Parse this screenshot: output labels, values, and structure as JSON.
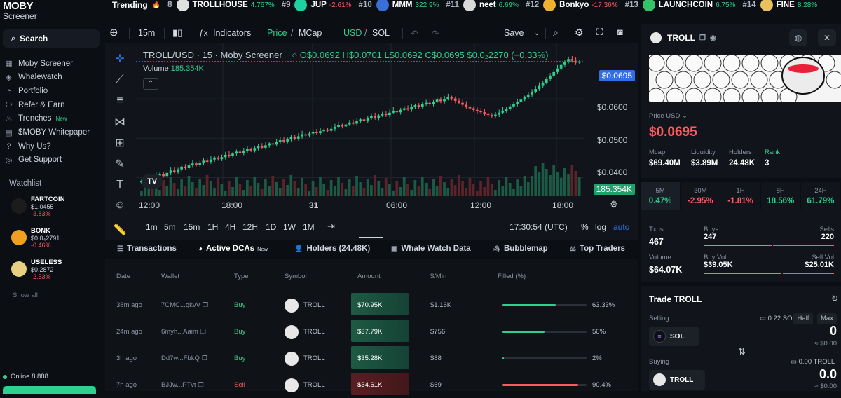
{
  "logo": {
    "line1": "MOBY",
    "line2": "Screener"
  },
  "trending": {
    "label": "Trending",
    "items": [
      {
        "rank": "8",
        "name": "TROLLHOUSE",
        "pct": "4.767%",
        "dir": "up",
        "color": "#e0e0e0"
      },
      {
        "rank": "#9",
        "name": "JUP",
        "pct": "-2.61%",
        "dir": "down",
        "color": "#1fd0a0"
      },
      {
        "rank": "#10",
        "name": "MMM",
        "pct": "322.9%",
        "dir": "up",
        "color": "#3a6fd8"
      },
      {
        "rank": "#11",
        "name": "neet",
        "pct": "6.69%",
        "dir": "up",
        "color": "#d9d9d9"
      },
      {
        "rank": "#12",
        "name": "Bonkyo",
        "pct": "-17.36%",
        "dir": "down",
        "color": "#f0b030"
      },
      {
        "rank": "#13",
        "name": "LAUNCHCOIN",
        "pct": "6.75%",
        "dir": "up",
        "color": "#33c46a"
      },
      {
        "rank": "#14",
        "name": "FINE",
        "pct": "8.28%",
        "dir": "up",
        "color": "#e8c060"
      }
    ]
  },
  "sidebar": {
    "search_label": "Search",
    "items": [
      {
        "label": "Moby Screener",
        "icon": "grid-icon"
      },
      {
        "label": "Whalewatch",
        "icon": "whale-icon"
      },
      {
        "label": "Portfolio",
        "icon": "pie-icon"
      },
      {
        "label": "Refer & Earn",
        "icon": "gift-icon"
      },
      {
        "label": "Trenches",
        "icon": "trench-icon",
        "badge": "New"
      },
      {
        "label": "$MOBY Whitepaper",
        "icon": "doc-icon"
      },
      {
        "label": "Why Us?",
        "icon": "question-icon"
      },
      {
        "label": "Get Support",
        "icon": "support-icon"
      }
    ],
    "watchlist_title": "Watchlist",
    "watchlist": [
      {
        "name": "FARTCOIN",
        "price": "$1.0455",
        "pct": "-3.83%",
        "color": "#1c1c1c"
      },
      {
        "name": "BONK",
        "price": "$0.0₄2791",
        "pct": "-0.46%",
        "color": "#f0a020"
      },
      {
        "name": "USELESS",
        "price": "$0.2872",
        "pct": "-2.53%",
        "color": "#e8d080"
      }
    ],
    "show_all": "Show all",
    "online": "Online 8,888"
  },
  "chart_toolbar": {
    "interval": "15m",
    "indicators": "Indicators",
    "price": "Price",
    "mcap": "MCap",
    "usd": "USD",
    "sol": "SOL",
    "save": "Save",
    "slash": "/"
  },
  "chart": {
    "legend_title": "TROLL/USD · 15 · Moby Screener",
    "ohlc": {
      "o": "O$0.0692",
      "h": "H$0.0701",
      "l": "L$0.0692",
      "c": "C$0.0695",
      "chg": "$0.0₂2270 (+0.33%)"
    },
    "volume_label": "Volume",
    "volume_value": "185.354K",
    "price_tag": "$0.0695",
    "volume_tag": "185.354K",
    "y_ticks": [
      "$0.0600",
      "$0.0500",
      "$0.0400"
    ],
    "x_ticks": [
      "12:00",
      "18:00",
      "31",
      "06:00",
      "12:00",
      "18:00"
    ],
    "tv_logo": "TV",
    "timeframes": [
      "1m",
      "5m",
      "15m",
      "1H",
      "4H",
      "12H",
      "1D",
      "1W",
      "1M"
    ],
    "clock": "17:30:54 (UTC)",
    "pct": "%",
    "log": "log",
    "auto": "auto"
  },
  "chart_data": {
    "type": "candlestick",
    "title": "TROLL/USD · 15 · Moby Screener",
    "ylim": [
      0.036,
      0.073
    ],
    "y_ticks": [
      0.04,
      0.05,
      0.06
    ],
    "x_ticks": [
      "12:00",
      "18:00",
      "31",
      "06:00",
      "12:00",
      "18:00"
    ],
    "close": [
      0.0392,
      0.0396,
      0.0401,
      0.0397,
      0.0405,
      0.0409,
      0.0404,
      0.0412,
      0.0418,
      0.0415,
      0.0421,
      0.0428,
      0.0424,
      0.0431,
      0.0436,
      0.0432,
      0.0438,
      0.0443,
      0.044,
      0.0446,
      0.0451,
      0.0447,
      0.0452,
      0.0458,
      0.0455,
      0.0461,
      0.0466,
      0.0462,
      0.0468,
      0.0472,
      0.0469,
      0.0475,
      0.048,
      0.0476,
      0.0482,
      0.0487,
      0.0484,
      0.0491,
      0.0495,
      0.0492,
      0.0498,
      0.0503,
      0.0499,
      0.0505,
      0.051,
      0.0507,
      0.0512,
      0.0516,
      0.0513,
      0.0518,
      0.0522,
      0.0519,
      0.0524,
      0.0529,
      0.0533,
      0.053,
      0.0535,
      0.054,
      0.0537,
      0.0543,
      0.0548,
      0.0545,
      0.0551,
      0.0556,
      0.0552,
      0.0558,
      0.0562,
      0.0559,
      0.0565,
      0.057,
      0.0566,
      0.0572,
      0.0576,
      0.0573,
      0.0579,
      0.0584,
      0.058,
      0.0586,
      0.059,
      0.0587,
      0.0593,
      0.0598,
      0.0594,
      0.06,
      0.0604,
      0.0601,
      0.0595,
      0.059,
      0.0585,
      0.058,
      0.0576,
      0.0572,
      0.0569,
      0.0566,
      0.0562,
      0.0559,
      0.0556,
      0.056,
      0.0565,
      0.057,
      0.0575,
      0.0581,
      0.0586,
      0.0592,
      0.0598,
      0.0604,
      0.0611,
      0.0618,
      0.0625,
      0.0633,
      0.0641,
      0.065,
      0.0659,
      0.0668,
      0.0677,
      0.0686,
      0.0694,
      0.0701,
      0.0697,
      0.0692,
      0.0695
    ],
    "volume_note": "Volume"
  },
  "tabs": [
    {
      "label": "Transactions",
      "icon": "list-icon"
    },
    {
      "label": "Active DCAs",
      "icon": "dca-icon",
      "badge": "New"
    },
    {
      "label": "Holders (24.48K)",
      "icon": "users-icon"
    },
    {
      "label": "Whale Watch Data",
      "icon": "whale-icon"
    },
    {
      "label": "Bubblemap",
      "icon": "bubble-icon"
    },
    {
      "label": "Top Traders",
      "icon": "trophy-icon"
    }
  ],
  "table": {
    "headers": [
      "Date",
      "Wallet",
      "Type",
      "Symbol",
      "Amount",
      "$/Min",
      "Filled (%)"
    ],
    "rows": [
      {
        "date": "38m ago",
        "wallet": "7CMC...gkvV",
        "type": "Buy",
        "symbol": "TROLL",
        "amount": "$70.95K",
        "permin": "$1.16K",
        "filled": 63.33,
        "filled_label": "63.33%"
      },
      {
        "date": "24m ago",
        "wallet": "6myh...Aaim",
        "type": "Buy",
        "symbol": "TROLL",
        "amount": "$37.79K",
        "permin": "$756",
        "filled": 50,
        "filled_label": "50%"
      },
      {
        "date": "3h ago",
        "wallet": "Dd7w...FbkQ",
        "type": "Buy",
        "symbol": "TROLL",
        "amount": "$35.28K",
        "permin": "$88",
        "filled": 2,
        "filled_label": "2%"
      },
      {
        "date": "7h ago",
        "wallet": "BJJw...PTvt",
        "type": "Sell",
        "symbol": "TROLL",
        "amount": "$34.61K",
        "permin": "$69",
        "filled": 90.4,
        "filled_label": "90.4%"
      }
    ]
  },
  "token": {
    "name": "TROLL",
    "price_label": "Price USD",
    "price": "$0.0695",
    "stats": [
      {
        "label": "Mcap",
        "value": "$69.40M"
      },
      {
        "label": "Liquidity",
        "value": "$3.89M"
      },
      {
        "label": "Holders",
        "value": "24.48K"
      },
      {
        "label": "Rank",
        "value": "3"
      }
    ],
    "timeframes": [
      {
        "label": "5M",
        "pct": "0.47%",
        "dir": "up"
      },
      {
        "label": "30M",
        "pct": "-2.95%",
        "dir": "down"
      },
      {
        "label": "1H",
        "pct": "-1.81%",
        "dir": "down"
      },
      {
        "label": "8H",
        "pct": "18.56%",
        "dir": "up"
      },
      {
        "label": "24H",
        "pct": "61.79%",
        "dir": "up"
      }
    ],
    "txns_label": "Txns",
    "txns": "467",
    "buys_label": "Buys",
    "buys": "247",
    "sells_label": "Sells",
    "sells": "220",
    "volume_label": "Volume",
    "volume": "$64.07K",
    "buyvol_label": "Buy Vol",
    "buyvol": "$39.05K",
    "sellvol_label": "Sell Vol",
    "sellvol": "$25.01K",
    "buy_ratio": 0.53,
    "buyvol_ratio": 0.61
  },
  "trade": {
    "title": "Trade TROLL",
    "selling_label": "Selling",
    "sol_balance": "0.22 SOL",
    "half": "Half",
    "max": "Max",
    "sell_token": "SOL",
    "sell_amount": "0",
    "sell_usd": "≈ $0.00",
    "buying_label": "Buying",
    "troll_balance": "0.00 TROLL",
    "buy_token": "TROLL",
    "buy_amount": "0.0",
    "buy_usd": "≈ $0.00"
  },
  "colors": {
    "green": "#2fd08f",
    "red": "#ff5a5f",
    "accent_blue": "#2f6fe0"
  }
}
